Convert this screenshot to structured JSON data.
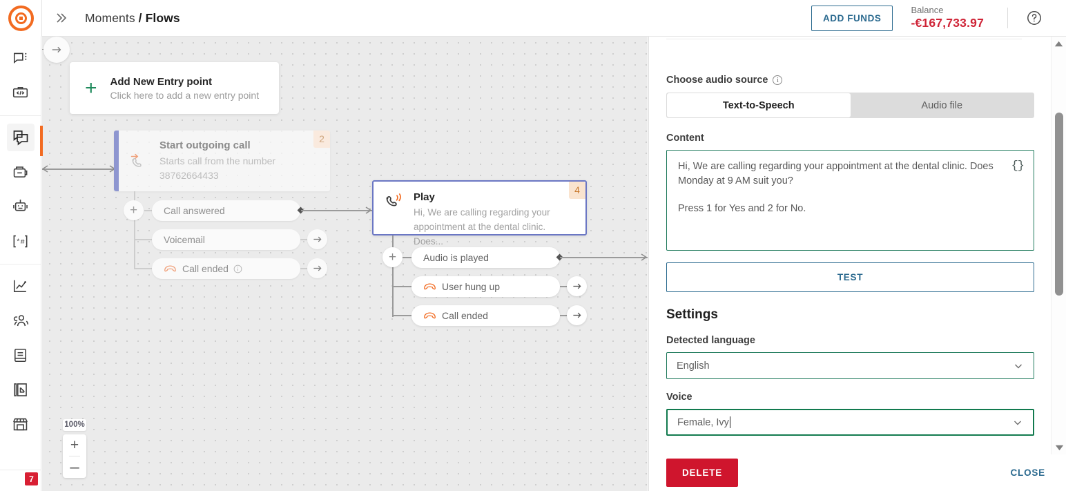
{
  "header": {
    "logo": "logo-mark",
    "expand_icon": "double-chevron-right-icon",
    "breadcrumb_root": "Moments",
    "breadcrumb_sep": "/",
    "breadcrumb_current": "Flows",
    "add_funds_label": "ADD FUNDS",
    "balance_label": "Balance",
    "balance_value": "-€167,733.97",
    "balance_color": "#cf2437",
    "help_icon": "question-circle-icon"
  },
  "sidebar": {
    "groups": [
      {
        "items": [
          {
            "name": "conversations-icon",
            "active": false
          },
          {
            "name": "code-toolbox-icon",
            "active": false
          }
        ]
      },
      {
        "items": [
          {
            "name": "flows-icon",
            "active": true
          },
          {
            "name": "broadcast-icon",
            "active": false
          },
          {
            "name": "chatbot-icon",
            "active": false
          },
          {
            "name": "keyword-icon",
            "active": false
          }
        ]
      },
      {
        "items": [
          {
            "name": "analytics-icon",
            "active": false
          },
          {
            "name": "people-icon",
            "active": false
          },
          {
            "name": "content-icon",
            "active": false
          },
          {
            "name": "forms-icon",
            "active": false
          },
          {
            "name": "store-icon",
            "active": false
          }
        ]
      }
    ],
    "accent_color": "#f26b21",
    "badge_count": "7",
    "badge_color": "#d81f33"
  },
  "canvas": {
    "zoom_level": "100%",
    "zoom_in_label": "+",
    "zoom_out_label": "–",
    "entry_card": {
      "title": "Add New Entry point",
      "subtitle": "Click here to add a new entry point",
      "plus_color": "#1f8a5c"
    },
    "start_node": {
      "title": "Start outgoing call",
      "subtitle_line1": "Starts call from the number",
      "subtitle_line2": "38762664433",
      "badge": "2",
      "icon": "outgoing-call-icon",
      "outputs": [
        {
          "label": "Call answered",
          "icon": null,
          "has_info": false,
          "connected": true
        },
        {
          "label": "Voicemail",
          "icon": null,
          "has_info": false,
          "connected": false
        },
        {
          "label": "Call ended",
          "icon": "hangup-icon",
          "has_info": true,
          "connected": false
        }
      ]
    },
    "play_node": {
      "title": "Play",
      "subtitle_line1": "Hi, We are calling regarding your",
      "subtitle_line2": "appointment at the dental clinic. Does...",
      "badge": "4",
      "icon": "play-audio-call-icon",
      "selected_border_color": "#6b77c4",
      "outputs": [
        {
          "label": "Audio is played",
          "icon": null,
          "connected": true
        },
        {
          "label": "User hung up",
          "icon": "hangup-icon",
          "connected": false
        },
        {
          "label": "Call ended",
          "icon": "hangup-icon",
          "connected": false
        }
      ]
    }
  },
  "panel": {
    "audio_source_label": "Choose audio source",
    "audio_source_tabs": [
      {
        "label": "Text-to-Speech",
        "active": true
      },
      {
        "label": "Audio file",
        "active": false
      }
    ],
    "content_label": "Content",
    "content_paragraph_1": "Hi,  We are calling regarding your appointment at the dental clinic. Does Monday at 9 AM suit you?",
    "content_paragraph_2": "Press 1 for Yes and 2 for No.",
    "placeholder_icon": "{}",
    "test_button_label": "TEST",
    "settings_heading": "Settings",
    "language_label": "Detected language",
    "language_value": "English",
    "voice_label": "Voice",
    "voice_value": "Female, Ivy",
    "chevron_icon": "chevron-down-icon",
    "focus_color": "#117a4e",
    "delete_label": "DELETE",
    "close_label": "CLOSE",
    "scrollbar": {
      "up_icon": "triangle-up-icon",
      "down_icon": "triangle-down-icon"
    }
  }
}
